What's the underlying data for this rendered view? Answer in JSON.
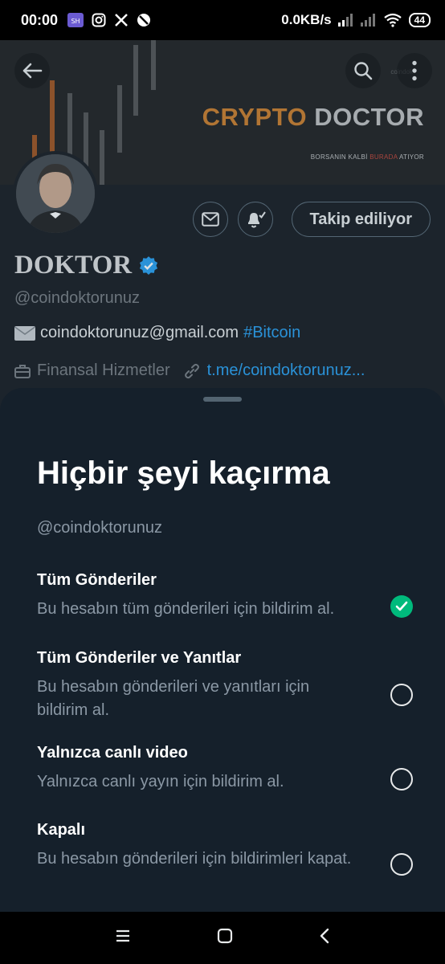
{
  "status_bar": {
    "time": "00:00",
    "network_speed": "0.0KB/s",
    "battery": "44"
  },
  "banner": {
    "title_part1": "CRYPTO",
    "title_part2": "DOCTOR",
    "tagline_part1": "BORSANIN KALBİ",
    "tagline_part2": "BURADA",
    "tagline_part3": "ATIYOR",
    "watermark": "coindok"
  },
  "profile": {
    "display_name": "DOKTOR",
    "handle": "@coindoktorunuz",
    "bio_email": "coindoktorunuz@gmail.com",
    "bio_hashtag": "#Bitcoin",
    "category": "Finansal Hizmetler",
    "link": "t.me/coindoktorunuz...",
    "follow_label": "Takip ediliyor"
  },
  "sheet": {
    "title": "Hiçbir şeyi kaçırma",
    "handle": "@coindoktorunuz",
    "options": [
      {
        "title": "Tüm Gönderiler",
        "desc": "Bu hesabın tüm gönderileri için bildirim al.",
        "selected": true
      },
      {
        "title": "Tüm Gönderiler ve Yanıtlar",
        "desc": "Bu hesabın gönderileri ve yanıtları için bildirim al.",
        "selected": false
      },
      {
        "title": "Yalnızca canlı video",
        "desc": "Yalnızca canlı yayın için bildirim al.",
        "selected": false
      },
      {
        "title": "Kapalı",
        "desc": "Bu hesabın gönderileri için bildirimleri kapat.",
        "selected": false
      }
    ]
  },
  "colors": {
    "accent": "#1d9bf0",
    "success": "#00ba7c",
    "sheet_bg": "#15202b"
  }
}
